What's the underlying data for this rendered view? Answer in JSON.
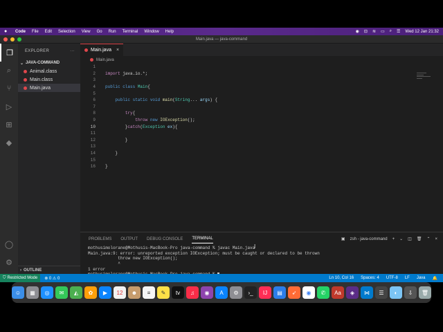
{
  "menubar": {
    "app_name": "Code",
    "items": [
      "File",
      "Edit",
      "Selection",
      "View",
      "Go",
      "Run",
      "Terminal",
      "Window",
      "Help"
    ],
    "clock": "Wed 12 Jan  21:32"
  },
  "window": {
    "title": "Main.java — java-command"
  },
  "sidebar": {
    "header": "EXPLORER",
    "more": "···",
    "folder": "JAVA-COMMAND",
    "files": [
      "Animal.class",
      "Main.class",
      "Main.java"
    ],
    "outline": "OUTLINE"
  },
  "editor": {
    "tab_label": "Main.java",
    "tab_close": "×",
    "breadcrumb": "Main.java",
    "line_numbers": [
      "1",
      "2",
      "3",
      "4",
      "5",
      "6",
      "7",
      "8",
      "9",
      "10",
      "11",
      "12",
      "13",
      "14",
      "15",
      "16"
    ]
  },
  "panel": {
    "tabs": [
      "PROBLEMS",
      "OUTPUT",
      "DEBUG CONSOLE",
      "TERMINAL"
    ],
    "terminal_label": "zsh - java-command",
    "terminal_lines": [
      "mothusimolorane@Mothusis-MacBook-Pro java-command % javac Main.java",
      "Main.java:9: error: unreported exception IOException; must be caught or declared to be thrown",
      "            throw new IOException();",
      "            ^",
      "1 error",
      "mothusimolorane@Mothusis-MacBook-Pro java-command % "
    ]
  },
  "statusbar": {
    "restricted": "Restricted Mode",
    "problems": "⊗ 0 ⚠ 0",
    "position": "Ln 10, Col 16",
    "spaces": "Spaces: 4",
    "encoding": "UTF-8",
    "eol": "LF",
    "language": "Java"
  },
  "colors": {
    "accent": "#007acc",
    "restricted": "#16825d",
    "java": "#e0474c"
  }
}
